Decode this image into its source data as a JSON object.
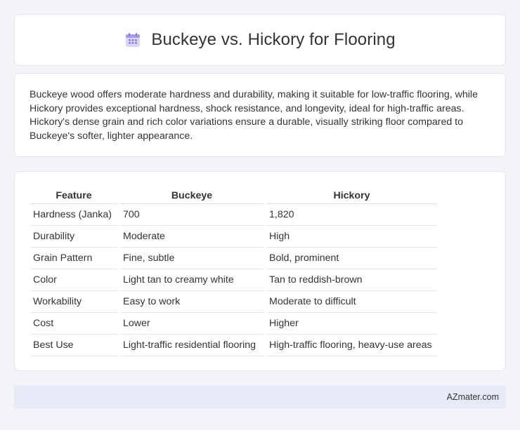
{
  "header": {
    "title": "Buckeye vs. Hickory for Flooring",
    "icon": "calendar-icon"
  },
  "summary": {
    "text": "Buckeye wood offers moderate hardness and durability, making it suitable for low-traffic flooring, while Hickory provides exceptional hardness, shock resistance, and longevity, ideal for high-traffic areas. Hickory's dense grain and rich color variations ensure a durable, visually striking floor compared to Buckeye's softer, lighter appearance."
  },
  "table": {
    "headers": [
      "Feature",
      "Buckeye",
      "Hickory"
    ],
    "rows": [
      [
        "Hardness (Janka)",
        "700",
        "1,820"
      ],
      [
        "Durability",
        "Moderate",
        "High"
      ],
      [
        "Grain Pattern",
        "Fine, subtle",
        "Bold, prominent"
      ],
      [
        "Color",
        "Light tan to creamy white",
        "Tan to reddish-brown"
      ],
      [
        "Workability",
        "Easy to work",
        "Moderate to difficult"
      ],
      [
        "Cost",
        "Lower",
        "Higher"
      ],
      [
        "Best Use",
        "Light-traffic residential flooring",
        "High-traffic flooring, heavy-use areas"
      ]
    ]
  },
  "footer": {
    "text": "AZmater.com"
  }
}
